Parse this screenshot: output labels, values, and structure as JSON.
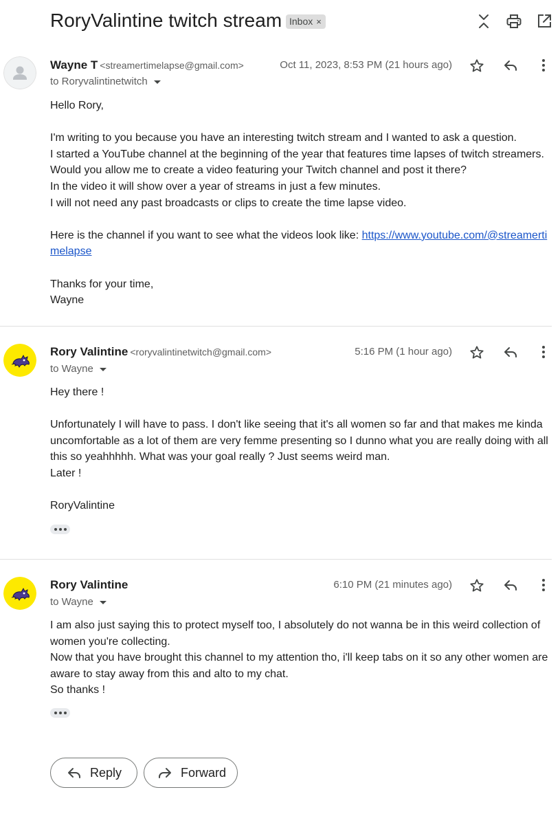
{
  "header": {
    "subject": "RoryValintine twitch stream",
    "label": "Inbox",
    "label_remove_glyph": "×",
    "icons": [
      "unfold-icon",
      "print-icon",
      "open-in-new-window-icon"
    ]
  },
  "messages": [
    {
      "sender_name": "Wayne T",
      "sender_email": "<streamertimelapse@gmail.com>",
      "recipient": "to Roryvalintinetwitch",
      "timestamp": "Oct 11, 2023, 8:53 PM (21 hours ago)",
      "avatar": "default-person-avatar",
      "body": {
        "greeting": "Hello Rory,",
        "lines": [
          "I'm writing to you because you have an interesting twitch stream and I wanted to ask a question.",
          "I started a YouTube channel at the beginning of the year that features time lapses of twitch streamers.",
          "Would you allow me to create a video featuring your Twitch channel and post it there?",
          "In the video it will show over a year of streams in just a few minutes.",
          "I will not need any past broadcasts or clips to create the time lapse video."
        ],
        "channel_text": "Here is the channel if you want to see what the videos look like: ",
        "channel_link": "https://www.youtube.com/@streamertimelapse",
        "closing": "Thanks for your time,",
        "signature": "Wayne"
      }
    },
    {
      "sender_name": "Rory Valintine",
      "sender_email": "<roryvalintinetwitch@gmail.com>",
      "recipient": "to Wayne",
      "timestamp": "5:16 PM (1 hour ago)",
      "avatar": "yellow-cat-avatar",
      "body": {
        "greeting": "Hey there !",
        "paragraph": "Unfortunately I will have to pass. I don't like seeing that it's all women so far and that makes me kinda uncomfortable as a lot of them are very femme presenting so I dunno what you are really doing with all this so yeahhhhh. What was your goal really ? Just seems weird man.",
        "closing": "Later !",
        "signature": "RoryValintine"
      }
    },
    {
      "sender_name": "Rory Valintine",
      "recipient": "to Wayne",
      "timestamp": "6:10 PM (21 minutes ago)",
      "avatar": "yellow-cat-avatar",
      "body": {
        "paragraph_1": "I am also just saying this to protect myself too, I absolutely do not wanna be in this weird collection of women you're collecting.",
        "paragraph_2": "Now that you have brought this channel to my attention tho, i'll keep tabs on it so any other women are aware to stay away from this and alto to my chat.",
        "closing": "So thanks !"
      }
    }
  ],
  "actions": {
    "reply_label": "Reply",
    "forward_label": "Forward"
  },
  "colors": {
    "link": "#1a55c9",
    "avatar_yellow": "#fde900",
    "chip_bg": "#dddddd",
    "divider": "#e0e0e0"
  }
}
